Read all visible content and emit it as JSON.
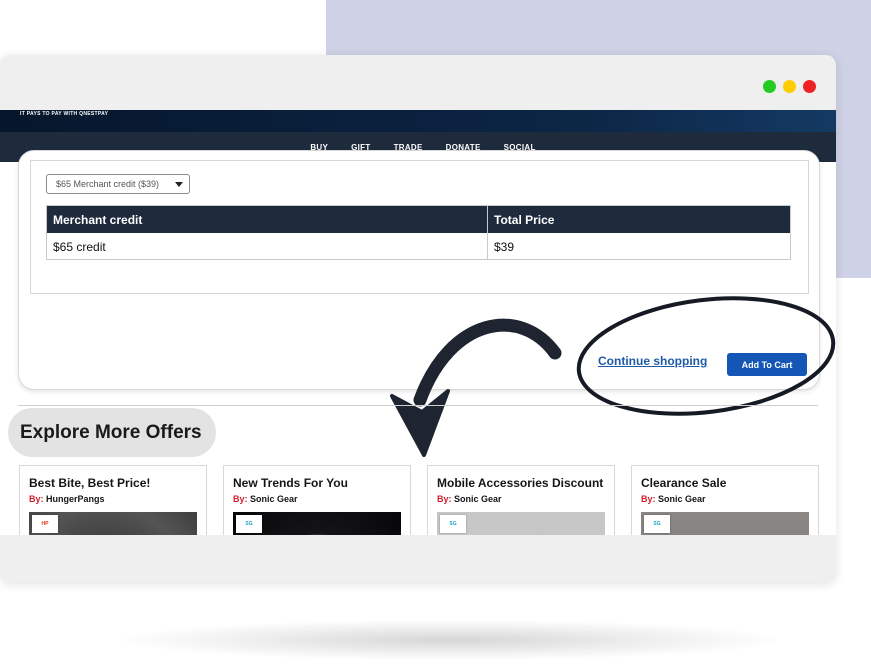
{
  "window": {
    "controls": [
      {
        "name": "minimize",
        "color": "#22cc22"
      },
      {
        "name": "maximize",
        "color": "#ffcc00"
      },
      {
        "name": "close",
        "color": "#ee2222"
      }
    ]
  },
  "site": {
    "tagline": "IT PAYS TO PAY WITH QNESTPAY",
    "nav": [
      "BUY",
      "GIFT",
      "TRADE",
      "DONATE",
      "SOCIAL"
    ]
  },
  "product": {
    "select_value": "$65 Merchant credit ($39)",
    "table": {
      "headers": [
        "Merchant credit",
        "Total Price"
      ],
      "row": [
        "$65 credit",
        "$39"
      ]
    },
    "continue_label": "Continue shopping",
    "add_to_cart_label": "Add To Cart"
  },
  "offers": {
    "heading": "Explore More Offers",
    "by_prefix": "By:",
    "items": [
      {
        "title": "Best Bite, Best Price!",
        "merchant": "HungerPangs",
        "image": "burger-bun-photo"
      },
      {
        "title": "New Trends For You",
        "merchant": "Sonic Gear",
        "image": "headphones-photo"
      },
      {
        "title": "Mobile Accessories Discount",
        "merchant": "Sonic Gear",
        "image": "speaker-powerbank-phone-photo"
      },
      {
        "title": "Clearance Sale",
        "merchant": "Sonic Gear",
        "image": "clearance-photo"
      }
    ]
  },
  "colors": {
    "brand_navy": "#1d2b3d",
    "button_blue": "#1356b5",
    "link_blue": "#1f5aa6",
    "accent_red": "#d21f2a",
    "backdrop_lavender": "#cfd2e6"
  }
}
